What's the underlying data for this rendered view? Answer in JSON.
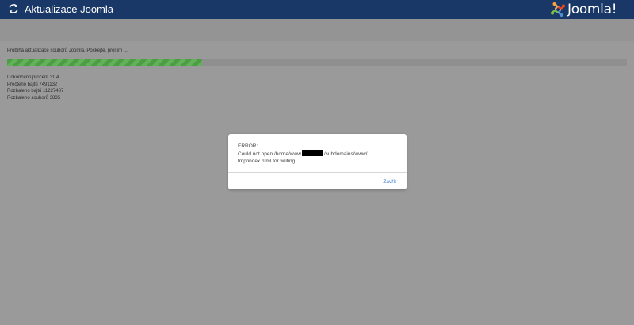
{
  "header": {
    "title": "Aktualizace Joomla",
    "refresh_icon": "refresh-icon",
    "logo_text": "Joomla!",
    "header_color": "#1a3867"
  },
  "update": {
    "status_message": "Probíhá aktualizace souborů Joomla. Počkejte, prosím ...",
    "progress_fraction": 0.314,
    "stats": {
      "percent": "Dokončeno procent 31.4",
      "bytes_read": "Přečteno bajtů 7491132",
      "bytes_unpacked": "Rozbaleno bajtů 11227487",
      "files_unpacked": "Rozbaleno souborů 3835"
    }
  },
  "modal": {
    "error_title": "ERROR:",
    "message_prefix": "Could not open /home/www",
    "message_mid": "/subdomains/www/",
    "message_suffix": "tmp/index.html for writing.",
    "close_label": "Zavřít"
  }
}
